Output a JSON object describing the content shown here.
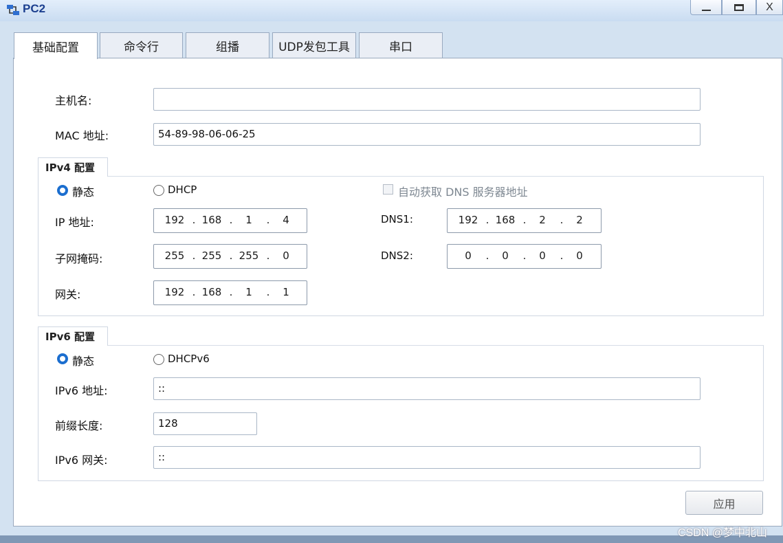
{
  "window": {
    "title": "PC2",
    "controls": {
      "minimize": "minimize-icon",
      "maximize": "maximize-icon",
      "close_label": "X"
    }
  },
  "tabs": [
    {
      "label": "基础配置",
      "active": true
    },
    {
      "label": "命令行",
      "active": false
    },
    {
      "label": "组播",
      "active": false
    },
    {
      "label": "UDP发包工具",
      "active": false
    },
    {
      "label": "串口",
      "active": false
    }
  ],
  "basic": {
    "hostname_label": "主机名:",
    "hostname_value": "",
    "mac_label": "MAC 地址:",
    "mac_value": "54-89-98-06-06-25"
  },
  "ipv4": {
    "group_label": "IPv4 配置",
    "static_label": "静态",
    "dhcp_label": "DHCP",
    "mode": "static",
    "auto_dns_label": "自动获取 DNS 服务器地址",
    "auto_dns_checked": false,
    "ip_label": "IP 地址:",
    "ip": [
      "192",
      "168",
      "1",
      "4"
    ],
    "mask_label": "子网掩码:",
    "mask": [
      "255",
      "255",
      "255",
      "0"
    ],
    "gateway_label": "网关:",
    "gateway": [
      "192",
      "168",
      "1",
      "1"
    ],
    "dns1_label": "DNS1:",
    "dns1": [
      "192",
      "168",
      "2",
      "2"
    ],
    "dns2_label": "DNS2:",
    "dns2": [
      "0",
      "0",
      "0",
      "0"
    ]
  },
  "ipv6": {
    "group_label": "IPv6 配置",
    "static_label": "静态",
    "dhcpv6_label": "DHCPv6",
    "mode": "static",
    "addr_label": "IPv6 地址:",
    "addr_value": "::",
    "prefix_label": "前缀长度:",
    "prefix_value": "128",
    "gateway_label": "IPv6 网关:",
    "gateway_value": "::"
  },
  "apply_label": "应用",
  "watermark": "CSDN @梦中北山",
  "colors": {
    "accent": "#1b6ecf",
    "title": "#1c3f8f"
  }
}
